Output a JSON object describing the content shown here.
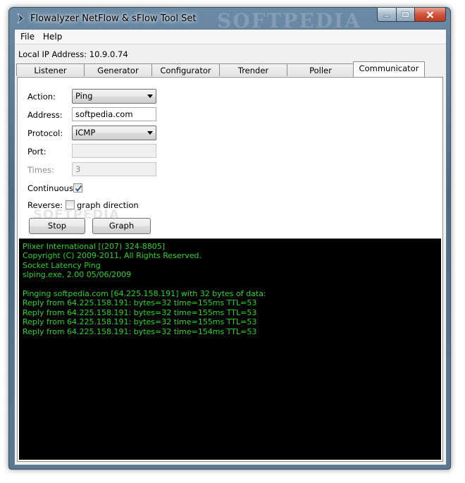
{
  "window": {
    "title": "Flowalyzer NetFlow & sFlow Tool Set",
    "watermark": "SOFTPEDIA"
  },
  "menu": {
    "items": [
      "File",
      "Help"
    ]
  },
  "local_ip": {
    "label": "Local IP Address: 10.9.0.74"
  },
  "tabs": [
    {
      "label": "Listener"
    },
    {
      "label": "Generator"
    },
    {
      "label": "Configurator"
    },
    {
      "label": "Trender"
    },
    {
      "label": "Poller"
    },
    {
      "label": "Communicator"
    }
  ],
  "form": {
    "action_label": "Action:",
    "action_value": "Ping",
    "address_label": "Address:",
    "address_value": "softpedia.com",
    "protocol_label": "Protocol:",
    "protocol_value": "ICMP",
    "port_label": "Port:",
    "port_value": "",
    "times_label": "Times:",
    "times_value": "3",
    "continuous_label": "Continuous:",
    "continuous_checked": true,
    "reverse_label": "Reverse:",
    "graph_direction_label": "graph direction",
    "graph_direction_checked": false,
    "stop_button": "Stop",
    "graph_button": "Graph",
    "overlay_watermark": "SOFTPEDIA"
  },
  "console": {
    "lines": [
      "Plixer International [(207) 324-8805]",
      "Copyright (C) 2009-2011, All Rights Reserved.",
      "Socket Latency Ping",
      "slping.exe, 2.00 05/06/2009",
      "",
      "Pinging softpedia.com [64.225.158.191] with 32 bytes of data:",
      "Reply from 64.225.158.191: bytes=32 time=155ms TTL=53",
      "Reply from 64.225.158.191: bytes=32 time=155ms TTL=53",
      "Reply from 64.225.158.191: bytes=32 time=155ms TTL=53",
      "Reply from 64.225.158.191: bytes=32 time=154ms TTL=53"
    ],
    "text_color": "#21d521",
    "background": "#000000"
  },
  "icons": {
    "app": "chevron-right-icon",
    "minimize": "minimize-icon",
    "maximize": "maximize-icon",
    "close": "close-icon"
  }
}
